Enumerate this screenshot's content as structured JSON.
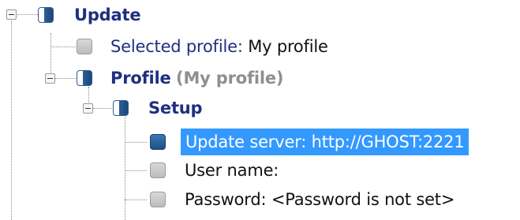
{
  "tree": {
    "update": {
      "label": "Update"
    },
    "selected_profile": {
      "label": "Selected profile:",
      "value": "My profile"
    },
    "profile": {
      "label": "Profile",
      "suffix": "(My profile)"
    },
    "setup": {
      "label": "Setup"
    },
    "update_server": {
      "text": "Update server: http://GHOST:2221"
    },
    "user_name": {
      "label": "User name:"
    },
    "password": {
      "label": "Password:",
      "value": "<Password is not set>"
    }
  },
  "colors": {
    "selection": "#3399ff",
    "heading": "#1f2f80",
    "muted": "#8f8f8f",
    "icon_blue": "#1f4f85",
    "icon_gray": "#bcbcbc"
  }
}
